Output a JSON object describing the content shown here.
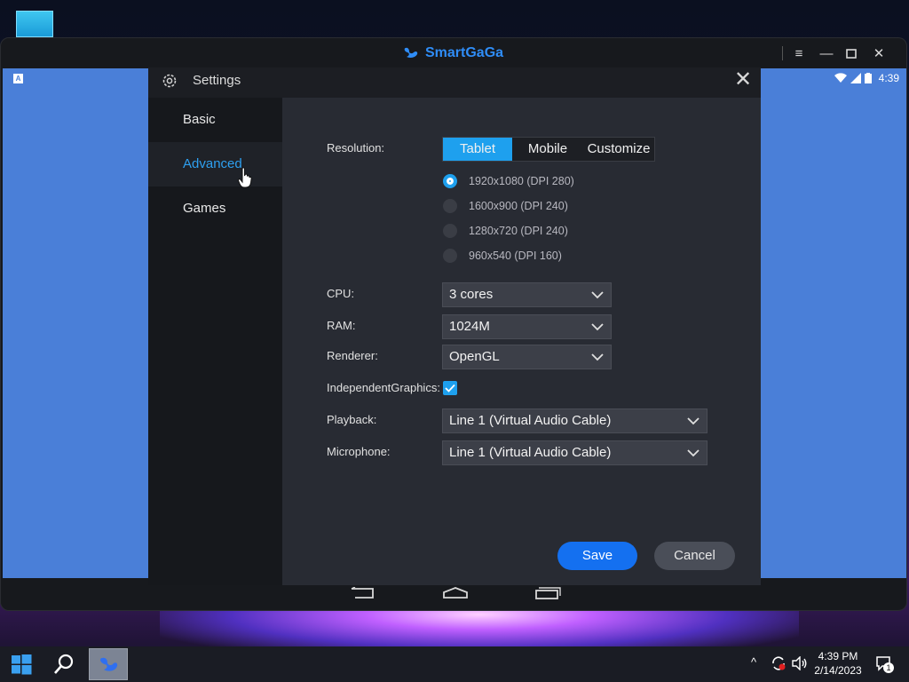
{
  "emulator": {
    "brand": "SmartGaGa",
    "controls": [
      "menu-icon",
      "minimize-icon",
      "maximize-icon",
      "close-icon"
    ]
  },
  "android": {
    "time": "4:39",
    "badge": "A"
  },
  "settings": {
    "title": "Settings",
    "sidebar": [
      {
        "label": "Basic",
        "active": false
      },
      {
        "label": "Advanced",
        "active": true
      },
      {
        "label": "Games",
        "active": false
      }
    ],
    "resolution": {
      "label": "Resolution:",
      "tabs": [
        {
          "label": "Tablet",
          "active": true
        },
        {
          "label": "Mobile",
          "active": false
        },
        {
          "label": "Customize",
          "active": false
        }
      ],
      "options": [
        {
          "label": "1920x1080 (DPI 280)",
          "selected": true
        },
        {
          "label": "1600x900 (DPI 240)",
          "selected": false
        },
        {
          "label": "1280x720 (DPI 240)",
          "selected": false
        },
        {
          "label": "960x540 (DPI 160)",
          "selected": false
        }
      ]
    },
    "cpu": {
      "label": "CPU:",
      "value": "3 cores"
    },
    "ram": {
      "label": "RAM:",
      "value": "1024M"
    },
    "renderer": {
      "label": "Renderer:",
      "value": "OpenGL"
    },
    "independent_graphics": {
      "label": "IndependentGraphics:",
      "checked": true
    },
    "playback": {
      "label": "Playback:",
      "value": "Line 1 (Virtual Audio Cable)"
    },
    "microphone": {
      "label": "Microphone:",
      "value": "Line 1 (Virtual Audio Cable)"
    },
    "save_label": "Save",
    "cancel_label": "Cancel"
  },
  "taskbar": {
    "time": "4:39 PM",
    "date": "2/14/2023",
    "notification_count": "1"
  },
  "colors": {
    "accent": "#1ea0ee",
    "save": "#1470f0",
    "android_bg": "#4a7fd8"
  }
}
